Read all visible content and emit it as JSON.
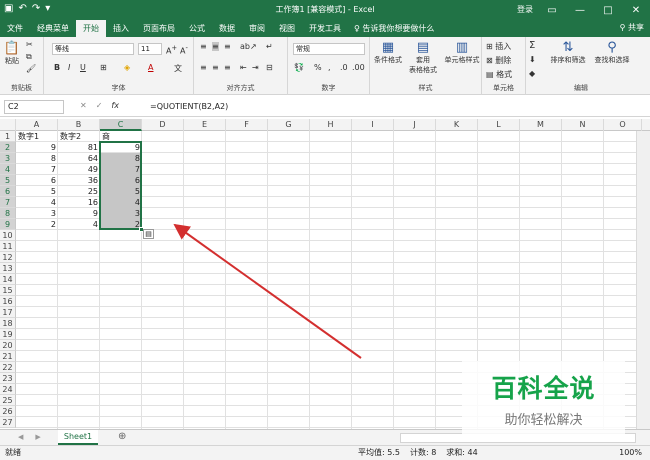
{
  "titlebar": {
    "title": "工作簿1  [兼容模式]  -  Excel",
    "login": "登录",
    "quick_access": [
      "save",
      "undo",
      "redo",
      "customize"
    ]
  },
  "tabs": [
    "文件",
    "经典菜单",
    "开始",
    "插入",
    "页面布局",
    "公式",
    "数据",
    "审阅",
    "视图",
    "开发工具"
  ],
  "active_tab": "开始",
  "tell_me": "告诉我你想要做什么",
  "share": "共享",
  "ribbon": {
    "paste": "粘贴",
    "font_name": "等线",
    "font_size": "11",
    "number_format": "常规",
    "cond_format": "条件格式",
    "table_format": "套用\n表格格式",
    "cell_style": "单元格样式",
    "insert": "插入",
    "delete": "删除",
    "format": "格式",
    "sort_filter": "排序和筛选",
    "find_select": "查找和选择",
    "groups": [
      "剪贴板",
      "字体",
      "对齐方式",
      "数字",
      "样式",
      "单元格",
      "编辑"
    ]
  },
  "formula_bar": {
    "name_box": "C2",
    "formula": "=QUOTIENT(B2,A2)"
  },
  "columns": [
    "A",
    "B",
    "C",
    "D",
    "E",
    "F",
    "G",
    "H",
    "I",
    "J",
    "K",
    "L",
    "M",
    "N",
    "O"
  ],
  "row_count": 27,
  "cells": [
    {
      "r": 1,
      "c": 0,
      "v": "数字1"
    },
    {
      "r": 1,
      "c": 1,
      "v": "数字2"
    },
    {
      "r": 1,
      "c": 2,
      "v": "商"
    },
    {
      "r": 2,
      "c": 0,
      "v": "9"
    },
    {
      "r": 2,
      "c": 1,
      "v": "81"
    },
    {
      "r": 2,
      "c": 2,
      "v": "9"
    },
    {
      "r": 3,
      "c": 0,
      "v": "8"
    },
    {
      "r": 3,
      "c": 1,
      "v": "64"
    },
    {
      "r": 3,
      "c": 2,
      "v": "8"
    },
    {
      "r": 4,
      "c": 0,
      "v": "7"
    },
    {
      "r": 4,
      "c": 1,
      "v": "49"
    },
    {
      "r": 4,
      "c": 2,
      "v": "7"
    },
    {
      "r": 5,
      "c": 0,
      "v": "6"
    },
    {
      "r": 5,
      "c": 1,
      "v": "36"
    },
    {
      "r": 5,
      "c": 2,
      "v": "6"
    },
    {
      "r": 6,
      "c": 0,
      "v": "5"
    },
    {
      "r": 6,
      "c": 1,
      "v": "25"
    },
    {
      "r": 6,
      "c": 2,
      "v": "5"
    },
    {
      "r": 7,
      "c": 0,
      "v": "4"
    },
    {
      "r": 7,
      "c": 1,
      "v": "16"
    },
    {
      "r": 7,
      "c": 2,
      "v": "4"
    },
    {
      "r": 8,
      "c": 0,
      "v": "3"
    },
    {
      "r": 8,
      "c": 1,
      "v": "9"
    },
    {
      "r": 8,
      "c": 2,
      "v": "3"
    },
    {
      "r": 9,
      "c": 0,
      "v": "2"
    },
    {
      "r": 9,
      "c": 1,
      "v": "4"
    },
    {
      "r": 9,
      "c": 2,
      "v": "2"
    }
  ],
  "sheet_tab": "Sheet1",
  "status": {
    "ready": "就绪",
    "average": "平均值: 5.5",
    "count": "计数: 8",
    "sum": "求和: 44",
    "zoom": "100%"
  },
  "watermark": {
    "line1": "百科全说",
    "line2": "助你轻松解决"
  },
  "colors": {
    "accent": "#217346",
    "arrow": "#d32f2f",
    "watermark": "#16a34a"
  }
}
